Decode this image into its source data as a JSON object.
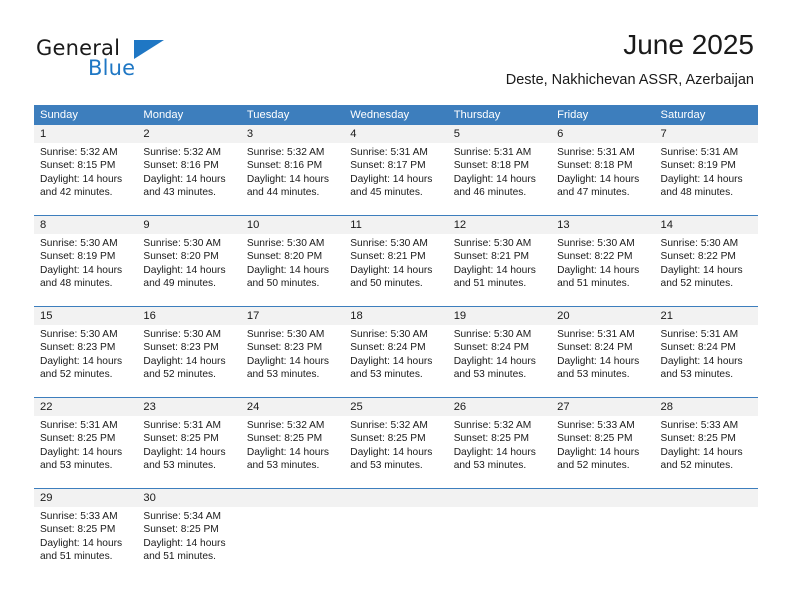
{
  "brand": {
    "name_primary": "General",
    "name_secondary": "Blue",
    "accent_color": "#1f77c4"
  },
  "header": {
    "title": "June 2025",
    "subtitle": "Deste, Nakhichevan ASSR, Azerbaijan"
  },
  "calendar": {
    "header_bg": "#3d7ebd",
    "date_band_bg": "#f2f2f2",
    "weekday_headers": [
      "Sunday",
      "Monday",
      "Tuesday",
      "Wednesday",
      "Thursday",
      "Friday",
      "Saturday"
    ],
    "weeks": [
      [
        {
          "day": "1",
          "sunrise": "Sunrise: 5:32 AM",
          "sunset": "Sunset: 8:15 PM",
          "daylight_line1": "Daylight: 14 hours",
          "daylight_line2": "and 42 minutes."
        },
        {
          "day": "2",
          "sunrise": "Sunrise: 5:32 AM",
          "sunset": "Sunset: 8:16 PM",
          "daylight_line1": "Daylight: 14 hours",
          "daylight_line2": "and 43 minutes."
        },
        {
          "day": "3",
          "sunrise": "Sunrise: 5:32 AM",
          "sunset": "Sunset: 8:16 PM",
          "daylight_line1": "Daylight: 14 hours",
          "daylight_line2": "and 44 minutes."
        },
        {
          "day": "4",
          "sunrise": "Sunrise: 5:31 AM",
          "sunset": "Sunset: 8:17 PM",
          "daylight_line1": "Daylight: 14 hours",
          "daylight_line2": "and 45 minutes."
        },
        {
          "day": "5",
          "sunrise": "Sunrise: 5:31 AM",
          "sunset": "Sunset: 8:18 PM",
          "daylight_line1": "Daylight: 14 hours",
          "daylight_line2": "and 46 minutes."
        },
        {
          "day": "6",
          "sunrise": "Sunrise: 5:31 AM",
          "sunset": "Sunset: 8:18 PM",
          "daylight_line1": "Daylight: 14 hours",
          "daylight_line2": "and 47 minutes."
        },
        {
          "day": "7",
          "sunrise": "Sunrise: 5:31 AM",
          "sunset": "Sunset: 8:19 PM",
          "daylight_line1": "Daylight: 14 hours",
          "daylight_line2": "and 48 minutes."
        }
      ],
      [
        {
          "day": "8",
          "sunrise": "Sunrise: 5:30 AM",
          "sunset": "Sunset: 8:19 PM",
          "daylight_line1": "Daylight: 14 hours",
          "daylight_line2": "and 48 minutes."
        },
        {
          "day": "9",
          "sunrise": "Sunrise: 5:30 AM",
          "sunset": "Sunset: 8:20 PM",
          "daylight_line1": "Daylight: 14 hours",
          "daylight_line2": "and 49 minutes."
        },
        {
          "day": "10",
          "sunrise": "Sunrise: 5:30 AM",
          "sunset": "Sunset: 8:20 PM",
          "daylight_line1": "Daylight: 14 hours",
          "daylight_line2": "and 50 minutes."
        },
        {
          "day": "11",
          "sunrise": "Sunrise: 5:30 AM",
          "sunset": "Sunset: 8:21 PM",
          "daylight_line1": "Daylight: 14 hours",
          "daylight_line2": "and 50 minutes."
        },
        {
          "day": "12",
          "sunrise": "Sunrise: 5:30 AM",
          "sunset": "Sunset: 8:21 PM",
          "daylight_line1": "Daylight: 14 hours",
          "daylight_line2": "and 51 minutes."
        },
        {
          "day": "13",
          "sunrise": "Sunrise: 5:30 AM",
          "sunset": "Sunset: 8:22 PM",
          "daylight_line1": "Daylight: 14 hours",
          "daylight_line2": "and 51 minutes."
        },
        {
          "day": "14",
          "sunrise": "Sunrise: 5:30 AM",
          "sunset": "Sunset: 8:22 PM",
          "daylight_line1": "Daylight: 14 hours",
          "daylight_line2": "and 52 minutes."
        }
      ],
      [
        {
          "day": "15",
          "sunrise": "Sunrise: 5:30 AM",
          "sunset": "Sunset: 8:23 PM",
          "daylight_line1": "Daylight: 14 hours",
          "daylight_line2": "and 52 minutes."
        },
        {
          "day": "16",
          "sunrise": "Sunrise: 5:30 AM",
          "sunset": "Sunset: 8:23 PM",
          "daylight_line1": "Daylight: 14 hours",
          "daylight_line2": "and 52 minutes."
        },
        {
          "day": "17",
          "sunrise": "Sunrise: 5:30 AM",
          "sunset": "Sunset: 8:23 PM",
          "daylight_line1": "Daylight: 14 hours",
          "daylight_line2": "and 53 minutes."
        },
        {
          "day": "18",
          "sunrise": "Sunrise: 5:30 AM",
          "sunset": "Sunset: 8:24 PM",
          "daylight_line1": "Daylight: 14 hours",
          "daylight_line2": "and 53 minutes."
        },
        {
          "day": "19",
          "sunrise": "Sunrise: 5:30 AM",
          "sunset": "Sunset: 8:24 PM",
          "daylight_line1": "Daylight: 14 hours",
          "daylight_line2": "and 53 minutes."
        },
        {
          "day": "20",
          "sunrise": "Sunrise: 5:31 AM",
          "sunset": "Sunset: 8:24 PM",
          "daylight_line1": "Daylight: 14 hours",
          "daylight_line2": "and 53 minutes."
        },
        {
          "day": "21",
          "sunrise": "Sunrise: 5:31 AM",
          "sunset": "Sunset: 8:24 PM",
          "daylight_line1": "Daylight: 14 hours",
          "daylight_line2": "and 53 minutes."
        }
      ],
      [
        {
          "day": "22",
          "sunrise": "Sunrise: 5:31 AM",
          "sunset": "Sunset: 8:25 PM",
          "daylight_line1": "Daylight: 14 hours",
          "daylight_line2": "and 53 minutes."
        },
        {
          "day": "23",
          "sunrise": "Sunrise: 5:31 AM",
          "sunset": "Sunset: 8:25 PM",
          "daylight_line1": "Daylight: 14 hours",
          "daylight_line2": "and 53 minutes."
        },
        {
          "day": "24",
          "sunrise": "Sunrise: 5:32 AM",
          "sunset": "Sunset: 8:25 PM",
          "daylight_line1": "Daylight: 14 hours",
          "daylight_line2": "and 53 minutes."
        },
        {
          "day": "25",
          "sunrise": "Sunrise: 5:32 AM",
          "sunset": "Sunset: 8:25 PM",
          "daylight_line1": "Daylight: 14 hours",
          "daylight_line2": "and 53 minutes."
        },
        {
          "day": "26",
          "sunrise": "Sunrise: 5:32 AM",
          "sunset": "Sunset: 8:25 PM",
          "daylight_line1": "Daylight: 14 hours",
          "daylight_line2": "and 53 minutes."
        },
        {
          "day": "27",
          "sunrise": "Sunrise: 5:33 AM",
          "sunset": "Sunset: 8:25 PM",
          "daylight_line1": "Daylight: 14 hours",
          "daylight_line2": "and 52 minutes."
        },
        {
          "day": "28",
          "sunrise": "Sunrise: 5:33 AM",
          "sunset": "Sunset: 8:25 PM",
          "daylight_line1": "Daylight: 14 hours",
          "daylight_line2": "and 52 minutes."
        }
      ],
      [
        {
          "day": "29",
          "sunrise": "Sunrise: 5:33 AM",
          "sunset": "Sunset: 8:25 PM",
          "daylight_line1": "Daylight: 14 hours",
          "daylight_line2": "and 51 minutes."
        },
        {
          "day": "30",
          "sunrise": "Sunrise: 5:34 AM",
          "sunset": "Sunset: 8:25 PM",
          "daylight_line1": "Daylight: 14 hours",
          "daylight_line2": "and 51 minutes."
        },
        {
          "day": "",
          "sunrise": "",
          "sunset": "",
          "daylight_line1": "",
          "daylight_line2": ""
        },
        {
          "day": "",
          "sunrise": "",
          "sunset": "",
          "daylight_line1": "",
          "daylight_line2": ""
        },
        {
          "day": "",
          "sunrise": "",
          "sunset": "",
          "daylight_line1": "",
          "daylight_line2": ""
        },
        {
          "day": "",
          "sunrise": "",
          "sunset": "",
          "daylight_line1": "",
          "daylight_line2": ""
        },
        {
          "day": "",
          "sunrise": "",
          "sunset": "",
          "daylight_line1": "",
          "daylight_line2": ""
        }
      ]
    ]
  }
}
